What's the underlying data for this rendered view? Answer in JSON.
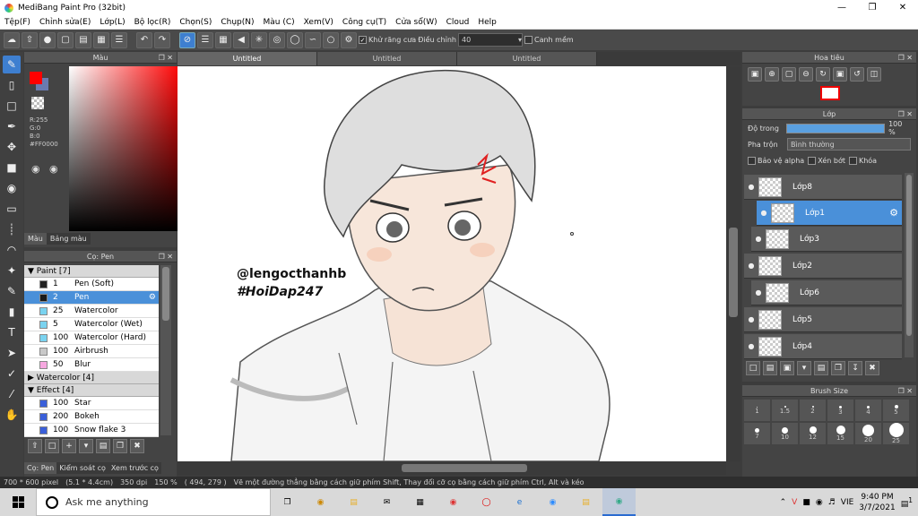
{
  "titlebar": {
    "title": "MediBang Paint Pro (32bit)"
  },
  "menu": [
    "Tệp(F)",
    "Chỉnh sửa(E)",
    "Lớp(L)",
    "Bộ lọc(R)",
    "Chọn(S)",
    "Chụp(N)",
    "Màu (C)",
    "Xem(V)",
    "Công cụ(T)",
    "Cửa sổ(W)",
    "Cloud",
    "Help"
  ],
  "toolbar": {
    "antialias_label": "Khử răng cưa",
    "adjust_label": "Điều chỉnh",
    "adjust_value": "40",
    "margin_label": "Canh mềm"
  },
  "colorpanel": {
    "title": "Màu",
    "r": "R:255",
    "g": "G:0",
    "b": "B:0",
    "hex": "#FF0000",
    "fg_color": "#ff0000",
    "tabs": [
      "Màu",
      "Bảng màu"
    ]
  },
  "brushpanel": {
    "title": "Cọ: Pen",
    "tabs": [
      "Cọ: Pen",
      "Kiểm soát cọ",
      "Xem trước cọ"
    ],
    "groups": [
      {
        "name": "Paint [7]",
        "items": [
          {
            "size": "1",
            "name": "Pen (Soft)",
            "color": "#222222"
          },
          {
            "size": "2",
            "name": "Pen",
            "color": "#1a1a1a"
          },
          {
            "size": "25",
            "name": "Watercolor",
            "color": "#7ad3f0"
          },
          {
            "size": "5",
            "name": "Watercolor (Wet)",
            "color": "#7ad3f0"
          },
          {
            "size": "100",
            "name": "Watercolor (Hard)",
            "color": "#7ad3f0"
          },
          {
            "size": "100",
            "name": "Airbrush",
            "color": "#c8c8c8"
          },
          {
            "size": "50",
            "name": "Blur",
            "color": "#f7a8e0"
          }
        ]
      },
      {
        "name": "Watercolor [4]",
        "items": []
      },
      {
        "name": "Effect [4]",
        "items": [
          {
            "size": "100",
            "name": "Star",
            "color": "#3a5fd9"
          },
          {
            "size": "200",
            "name": "Bokeh",
            "color": "#3a5fd9"
          },
          {
            "size": "100",
            "name": "Snow flake 3",
            "color": "#3a5fd9"
          }
        ]
      }
    ]
  },
  "doctabs": [
    "Untitled",
    "Untitled",
    "Untitled"
  ],
  "canvas": {
    "watermark1": "@lengocthanhb",
    "watermark2": "#HoiDap247"
  },
  "statusbar": {
    "dims": "700 * 600 pixel",
    "phys": "(5.1 * 4.4cm)",
    "dpi": "350 dpi",
    "zoom": "150 %",
    "coord": "( 494, 279 )",
    "hint": "Vẽ một đường thẳng bằng cách giữ phím Shift, Thay đổi cỡ cọ bằng cách giữ phím Ctrl, Alt và kéo"
  },
  "navpanel": {
    "title": "Hoa tiêu"
  },
  "layerpanel": {
    "title": "Lớp",
    "opacity_label": "Độ trong",
    "opacity_value": "100 %",
    "opacity_fraction": 1.0,
    "blend_label": "Pha trộn",
    "blend_value": "Bình thường",
    "protect_alpha": "Bảo vệ alpha",
    "clip": "Xén bớt",
    "lock": "Khóa",
    "layers": [
      "Lớp8",
      "Lớp1",
      "Lớp3",
      "Lớp2",
      "Lớp6",
      "Lớp5",
      "Lớp4"
    ]
  },
  "brushsize": {
    "title": "Brush Size",
    "labels": [
      "1",
      "1.5",
      "2",
      "3",
      "4",
      "5",
      "7",
      "10",
      "12",
      "15",
      "20",
      "25"
    ]
  },
  "taskbar": {
    "search_placeholder": "Ask me anything",
    "language": "VIE",
    "time": "9:40 PM",
    "date": "3/7/2021",
    "notif_count": "1"
  }
}
